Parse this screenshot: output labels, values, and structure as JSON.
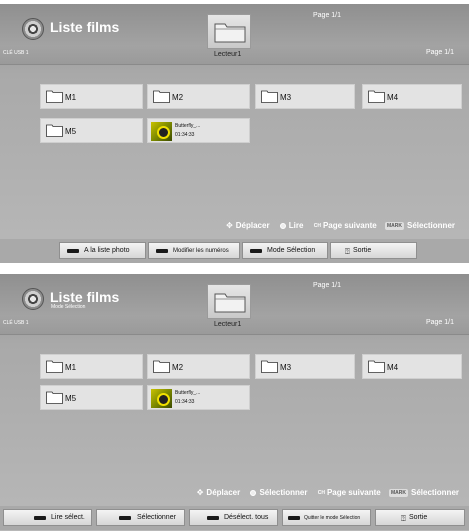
{
  "screens": [
    {
      "title": "Liste films",
      "subtitle": "",
      "usb_label": "CLÉ USB 1",
      "drive_label": "Lecteur1",
      "page_top": "Page 1/1",
      "page_right": "Page 1/1",
      "folders": [
        "M1",
        "M2",
        "M3",
        "M4",
        "M5"
      ],
      "video": {
        "name": "Butterfly_...",
        "duration": "01:34:33"
      },
      "legend": {
        "move": "Déplacer",
        "ok": "Lire",
        "ch_icon": "CH",
        "next": "Page suivante",
        "mark_icon": "MARK",
        "select": "Sélectionner"
      },
      "buttons": [
        "A la liste photo",
        "Modifier les numéros",
        "Mode Sélection",
        "Sortie"
      ]
    },
    {
      "title": "Liste films",
      "subtitle": "Mode Sélection",
      "usb_label": "CLÉ USB 1",
      "drive_label": "Lecteur1",
      "page_top": "Page 1/1",
      "page_right": "Page 1/1",
      "folders": [
        "M1",
        "M2",
        "M3",
        "M4",
        "M5"
      ],
      "video": {
        "name": "Butterfly_...",
        "duration": "01:34:33"
      },
      "legend": {
        "move": "Déplacer",
        "ok": "Sélectionner",
        "ch_icon": "CH",
        "next": "Page suivante",
        "mark_icon": "MARK",
        "select": "Sélectionner"
      },
      "buttons": [
        "Lire sélect.",
        "Sélectionner",
        "Désélect. tous",
        "Quitter le mode Sélection",
        "Sortie"
      ]
    }
  ],
  "icons": {
    "disc": "disc-icon",
    "folder": "folder-icon",
    "move": "four-way-arrow-icon",
    "ok": "ok-icon",
    "exit": "exit-icon"
  },
  "colors": {
    "background": "#b0b0b0",
    "tile": "#e3e3e3",
    "button": "#e6e6e6",
    "text": "#ffffff"
  }
}
